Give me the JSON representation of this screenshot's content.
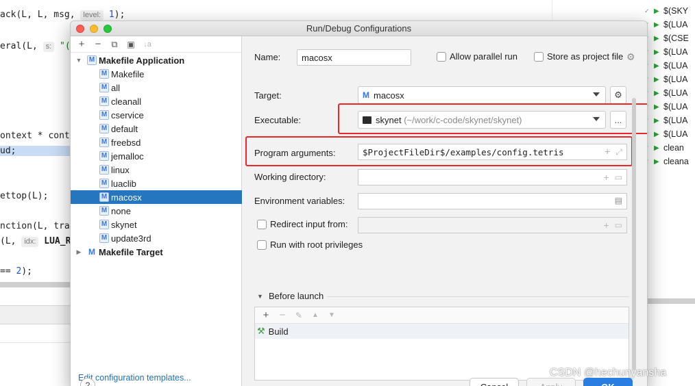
{
  "editor": {
    "lines": [
      {
        "pre": "ack(L, L, msg, ",
        "hint": "level:",
        "num": "1",
        "post": ");"
      },
      {
        "pre": "eral(L, ",
        "hint": "s:",
        "post2": " \"(r"
      },
      {
        "text": "ontext * conte"
      },
      {
        "text": "ud;"
      },
      {
        "text": "ettop(L);"
      },
      {
        "text": "nction(L, trac"
      },
      {
        "pre": "(L, ",
        "hint": "idx:",
        "post2": " LUA_R"
      },
      {
        "pre": "== ",
        "num": "2",
        "post": ");"
      }
    ]
  },
  "right_tree": {
    "items": [
      "$(SKY",
      "$(LUA",
      "$(CSE",
      "$(LUA",
      "$(LUA",
      "$(LUA",
      "$(LUA",
      "$(LUA",
      "$(LUA",
      "$(LUA",
      "clean",
      "cleana"
    ]
  },
  "dialog": {
    "title": "Run/Debug Configurations",
    "toolbar": {
      "add": "+",
      "remove": "−",
      "copy": "⧉",
      "folder": "▣",
      "sort": "↓a"
    },
    "tree": {
      "group1": "Makefile Application",
      "items": [
        "Makefile",
        "all",
        "cleanall",
        "cservice",
        "default",
        "freebsd",
        "jemalloc",
        "linux",
        "luaclib",
        "macosx",
        "none",
        "skynet",
        "update3rd"
      ],
      "selected": "macosx",
      "group2": "Makefile Target"
    },
    "edit_templates": "Edit configuration templates...",
    "form": {
      "name_label": "Name:",
      "name_value": "macosx",
      "allow_parallel": "Allow parallel run",
      "store_project": "Store as project file",
      "target_label": "Target:",
      "target_value": "macosx",
      "executable_label": "Executable:",
      "executable_name": "skynet",
      "executable_path": "(~/work/c-code/skynet/skynet)",
      "browse": "...",
      "args_label": "Program arguments:",
      "args_value": "$ProjectFileDir$/examples/config.tetris",
      "workdir_label": "Working directory:",
      "env_label": "Environment variables:",
      "redirect_label": "Redirect input from:",
      "root_label": "Run with root privileges"
    },
    "before_launch": {
      "title": "Before launch",
      "item": "Build"
    },
    "buttons": {
      "help": "?",
      "cancel": "Cancel",
      "apply": "Apply",
      "ok": "OK"
    }
  },
  "watermark": "CSDN @hechunyansha",
  "colors": {
    "selection": "#2675bf",
    "highlight_box": "#e8262b",
    "ok_button": "#2a7de1"
  }
}
